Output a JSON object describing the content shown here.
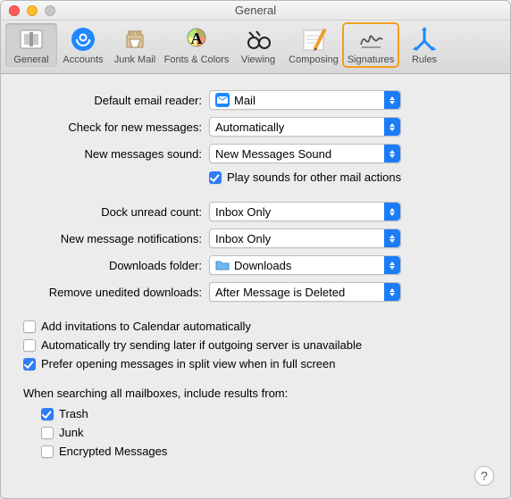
{
  "window": {
    "title": "General"
  },
  "toolbar": {
    "items": [
      {
        "label": "General"
      },
      {
        "label": "Accounts"
      },
      {
        "label": "Junk Mail"
      },
      {
        "label": "Fonts & Colors"
      },
      {
        "label": "Viewing"
      },
      {
        "label": "Composing"
      },
      {
        "label": "Signatures"
      },
      {
        "label": "Rules"
      }
    ]
  },
  "form": {
    "default_reader": {
      "label": "Default email reader:",
      "value": "Mail"
    },
    "check_messages": {
      "label": "Check for new messages:",
      "value": "Automatically"
    },
    "new_sound": {
      "label": "New messages sound:",
      "value": "New Messages Sound"
    },
    "play_sounds": {
      "label": "Play sounds for other mail actions",
      "checked": true
    },
    "dock_count": {
      "label": "Dock unread count:",
      "value": "Inbox Only"
    },
    "notifications": {
      "label": "New message notifications:",
      "value": "Inbox Only"
    },
    "downloads_folder": {
      "label": "Downloads folder:",
      "value": "Downloads"
    },
    "remove_downloads": {
      "label": "Remove unedited downloads:",
      "value": "After Message is Deleted"
    },
    "add_invitations": {
      "label": "Add invitations to Calendar automatically",
      "checked": false
    },
    "auto_retry": {
      "label": "Automatically try sending later if outgoing server is unavailable",
      "checked": false
    },
    "split_view": {
      "label": "Prefer opening messages in split view when in full screen",
      "checked": true
    },
    "search_heading": "When searching all mailboxes, include results from:",
    "search_trash": {
      "label": "Trash",
      "checked": true
    },
    "search_junk": {
      "label": "Junk",
      "checked": false
    },
    "search_encrypted": {
      "label": "Encrypted Messages",
      "checked": false
    }
  },
  "help": "?"
}
